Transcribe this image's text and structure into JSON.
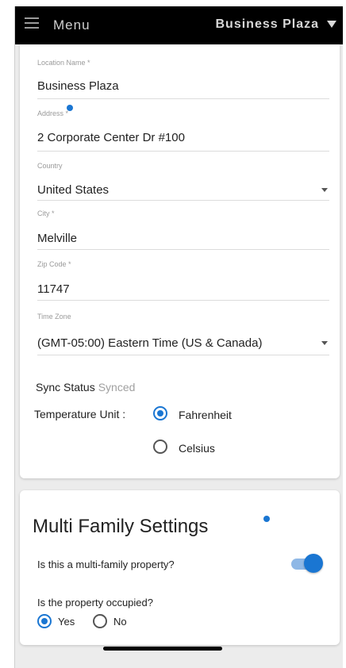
{
  "topbar": {
    "menu_label": "Menu",
    "site_name": "Business Plaza"
  },
  "location": {
    "name_label": "Location Name *",
    "name_value": "Business Plaza",
    "address_label": "Address *",
    "address_value": "2 Corporate Center Dr #100",
    "country_label": "Country",
    "country_value": "United States",
    "city_label": "City *",
    "city_value": "Melville",
    "zip_label": "Zip Code *",
    "zip_value": "11747",
    "timezone_label": "Time Zone",
    "timezone_value": "(GMT-05:00) Eastern Time (US & Canada)",
    "sync_label": "Sync Status",
    "sync_value": "Synced",
    "temp_label": "Temperature Unit :",
    "temp_options": [
      "Fahrenheit",
      "Celsius"
    ],
    "temp_selected": "Fahrenheit"
  },
  "multi_family": {
    "title": "Multi Family Settings",
    "question_multi": "Is this a multi-family property?",
    "multi_enabled": true,
    "question_occupied": "Is the property occupied?",
    "occupied_options": [
      "Yes",
      "No"
    ],
    "occupied_selected": "Yes"
  },
  "colors": {
    "accent": "#1a76d2",
    "topbar": "#000000"
  },
  "icons": {
    "menu": "hamburger-icon",
    "site_dropdown": "caret-down-icon",
    "info": "info-icon"
  }
}
